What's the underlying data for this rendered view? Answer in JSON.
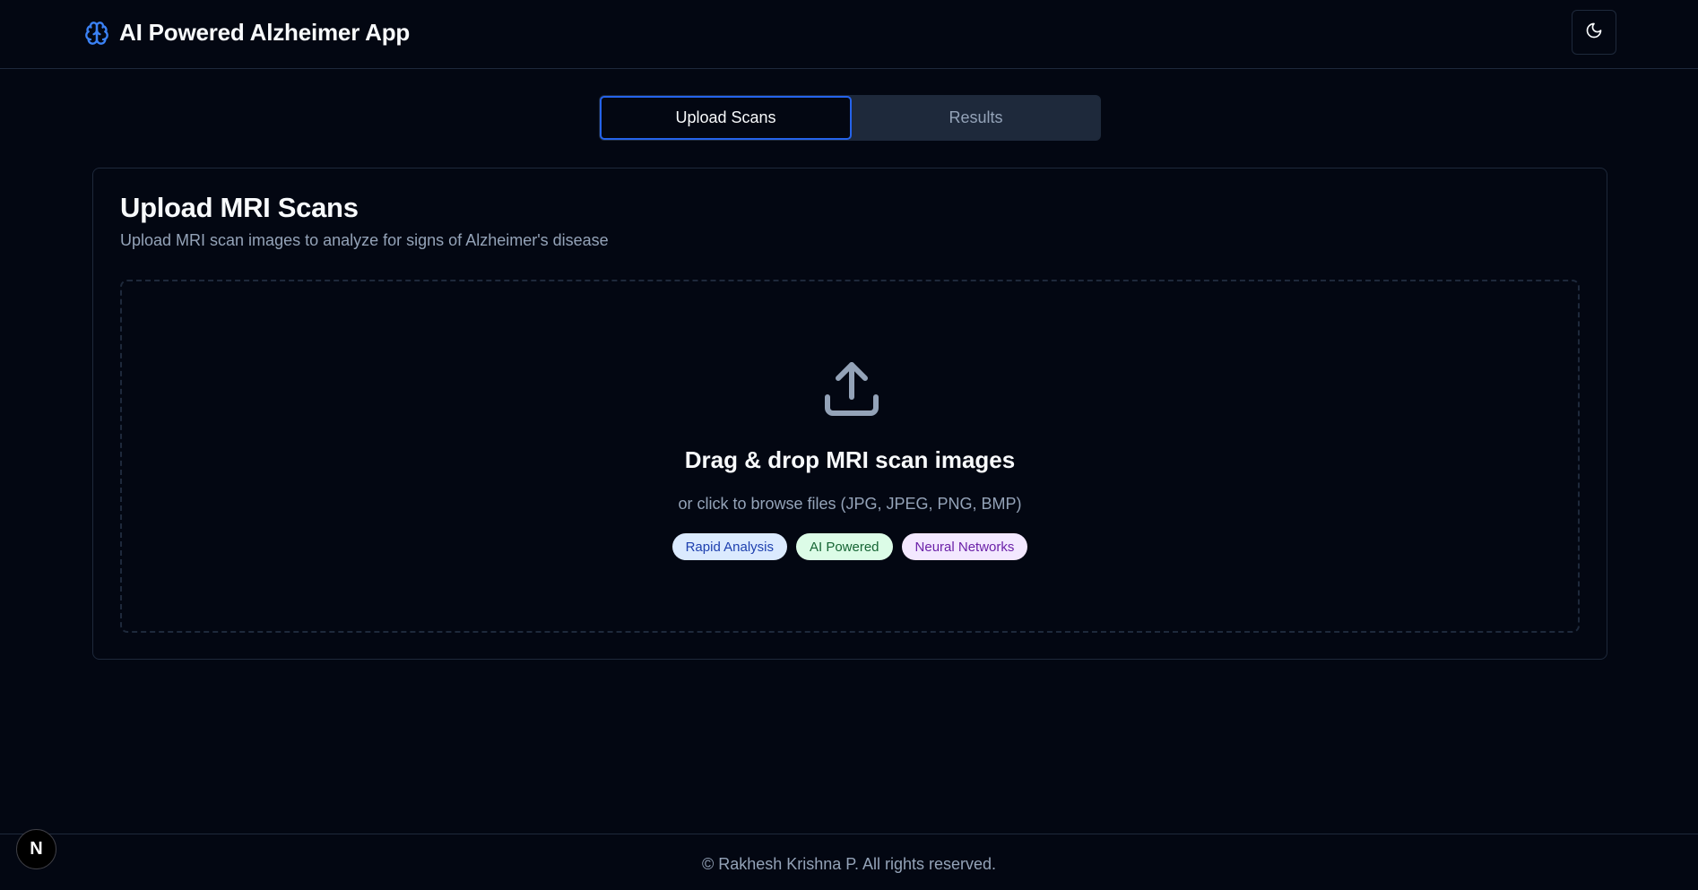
{
  "header": {
    "title": "AI Powered Alzheimer App",
    "brand_icon": "brain-icon",
    "theme_toggle_icon": "moon-icon"
  },
  "tabs": [
    {
      "label": "Upload Scans",
      "active": true
    },
    {
      "label": "Results",
      "active": false
    }
  ],
  "card": {
    "title": "Upload MRI Scans",
    "description": "Upload MRI scan images to analyze for signs of Alzheimer's disease"
  },
  "dropzone": {
    "icon": "upload-icon",
    "title": "Drag & drop MRI scan images",
    "subtitle": "or click to browse files (JPG, JPEG, PNG, BMP)",
    "badges": [
      {
        "label": "Rapid Analysis",
        "color": "#dbeafe"
      },
      {
        "label": "AI Powered",
        "color": "#dcfce7"
      },
      {
        "label": "Neural Networks",
        "color": "#f3e8ff"
      }
    ]
  },
  "footer": {
    "text": "© Rakhesh Krishna P. All rights reserved."
  },
  "dev_badge": {
    "label": "N"
  },
  "colors": {
    "background": "#030712",
    "accent": "#2563eb",
    "border": "#1e293b",
    "muted_text": "#94a3b8"
  }
}
